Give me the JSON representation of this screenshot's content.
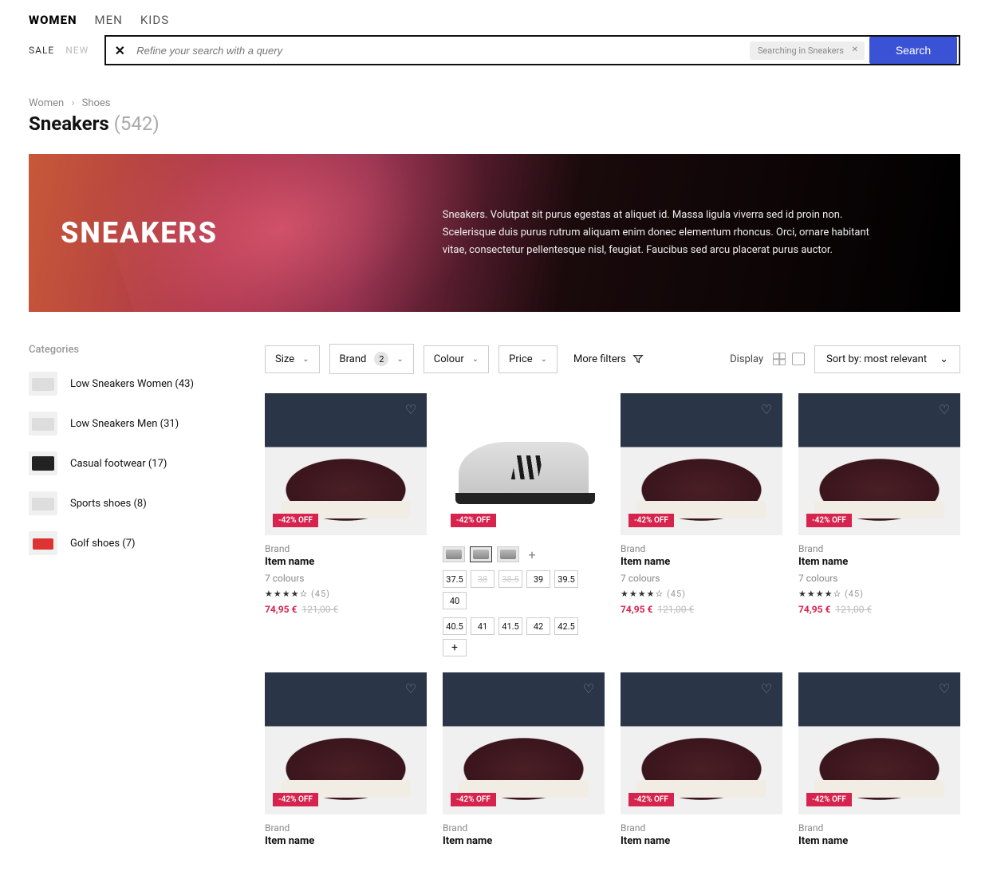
{
  "nav": {
    "items": [
      "WOMEN",
      "MEN",
      "KIDS"
    ],
    "active": 0
  },
  "subnav": {
    "sale": "SALE",
    "new": "NEW"
  },
  "search": {
    "placeholder": "Refine your search with a query",
    "context": "Searching in Sneakers",
    "button": "Search"
  },
  "breadcrumb": [
    "Women",
    "Shoes"
  ],
  "title": "Sneakers",
  "count": "(542)",
  "hero": {
    "heading": "SNEAKERS",
    "body": "Sneakers. Volutpat sit purus egestas at aliquet id. Massa ligula viverra sed id proin non. Scelerisque duis purus rutrum aliquam enim donec elementum rhoncus. Orci, ornare habitant vitae, consectetur pellentesque nisl, feugiat. Faucibus sed arcu placerat purus auctor."
  },
  "sidebar": {
    "heading": "Categories",
    "items": [
      {
        "label": "Low Sneakers Women (43)",
        "thumb": "light"
      },
      {
        "label": "Low Sneakers Men (31)",
        "thumb": "light"
      },
      {
        "label": "Casual footwear (17)",
        "thumb": "dark"
      },
      {
        "label": "Sports shoes (8)",
        "thumb": "light"
      },
      {
        "label": "Golf shoes (7)",
        "thumb": "red"
      }
    ]
  },
  "filters": {
    "size": "Size",
    "brand": "Brand",
    "brand_count": "2",
    "colour": "Colour",
    "price": "Price",
    "more": "More filters",
    "display": "Display",
    "sort": "Sort by: most relevant"
  },
  "discount_badge": "-42% OFF",
  "product_common": {
    "brand": "Brand",
    "name": "Item name",
    "rating_stars": "★★★★☆",
    "rating_count": "(45)",
    "colours": "7 colours",
    "price_now": "74,95 €",
    "price_was": "121,00 €"
  },
  "variant_card": {
    "sizes_row1": [
      "37.5",
      "38",
      "38.5",
      "39",
      "39.5",
      "40"
    ],
    "sizes_row1_na": [
      1,
      2
    ],
    "sizes_row2": [
      "40.5",
      "41",
      "41.5",
      "42",
      "42.5"
    ]
  }
}
